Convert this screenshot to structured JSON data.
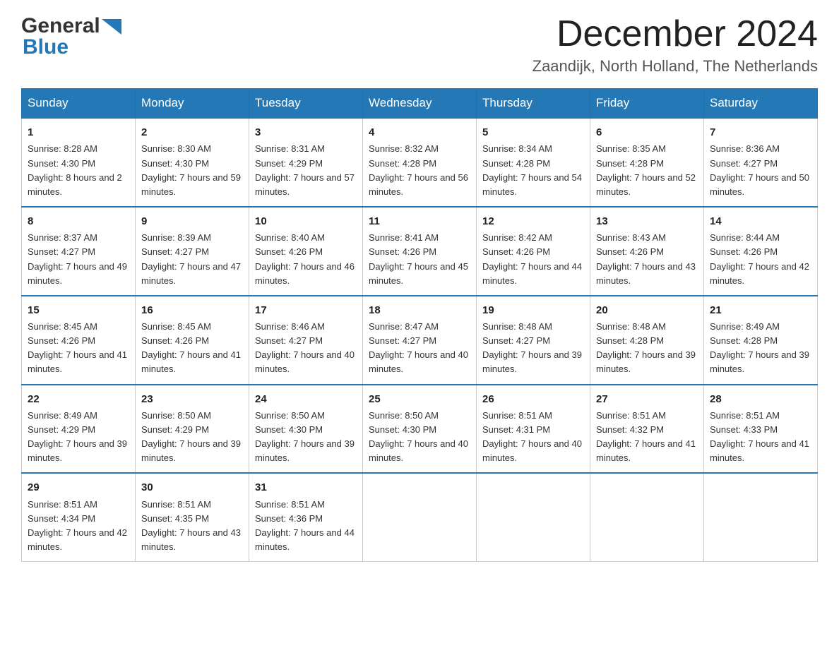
{
  "header": {
    "logo_general": "General",
    "logo_blue": "Blue",
    "month_title": "December 2024",
    "location": "Zaandijk, North Holland, The Netherlands"
  },
  "weekdays": [
    "Sunday",
    "Monday",
    "Tuesday",
    "Wednesday",
    "Thursday",
    "Friday",
    "Saturday"
  ],
  "weeks": [
    [
      {
        "day": "1",
        "sunrise": "8:28 AM",
        "sunset": "4:30 PM",
        "daylight": "8 hours and 2 minutes."
      },
      {
        "day": "2",
        "sunrise": "8:30 AM",
        "sunset": "4:30 PM",
        "daylight": "7 hours and 59 minutes."
      },
      {
        "day": "3",
        "sunrise": "8:31 AM",
        "sunset": "4:29 PM",
        "daylight": "7 hours and 57 minutes."
      },
      {
        "day": "4",
        "sunrise": "8:32 AM",
        "sunset": "4:28 PM",
        "daylight": "7 hours and 56 minutes."
      },
      {
        "day": "5",
        "sunrise": "8:34 AM",
        "sunset": "4:28 PM",
        "daylight": "7 hours and 54 minutes."
      },
      {
        "day": "6",
        "sunrise": "8:35 AM",
        "sunset": "4:28 PM",
        "daylight": "7 hours and 52 minutes."
      },
      {
        "day": "7",
        "sunrise": "8:36 AM",
        "sunset": "4:27 PM",
        "daylight": "7 hours and 50 minutes."
      }
    ],
    [
      {
        "day": "8",
        "sunrise": "8:37 AM",
        "sunset": "4:27 PM",
        "daylight": "7 hours and 49 minutes."
      },
      {
        "day": "9",
        "sunrise": "8:39 AM",
        "sunset": "4:27 PM",
        "daylight": "7 hours and 47 minutes."
      },
      {
        "day": "10",
        "sunrise": "8:40 AM",
        "sunset": "4:26 PM",
        "daylight": "7 hours and 46 minutes."
      },
      {
        "day": "11",
        "sunrise": "8:41 AM",
        "sunset": "4:26 PM",
        "daylight": "7 hours and 45 minutes."
      },
      {
        "day": "12",
        "sunrise": "8:42 AM",
        "sunset": "4:26 PM",
        "daylight": "7 hours and 44 minutes."
      },
      {
        "day": "13",
        "sunrise": "8:43 AM",
        "sunset": "4:26 PM",
        "daylight": "7 hours and 43 minutes."
      },
      {
        "day": "14",
        "sunrise": "8:44 AM",
        "sunset": "4:26 PM",
        "daylight": "7 hours and 42 minutes."
      }
    ],
    [
      {
        "day": "15",
        "sunrise": "8:45 AM",
        "sunset": "4:26 PM",
        "daylight": "7 hours and 41 minutes."
      },
      {
        "day": "16",
        "sunrise": "8:45 AM",
        "sunset": "4:26 PM",
        "daylight": "7 hours and 41 minutes."
      },
      {
        "day": "17",
        "sunrise": "8:46 AM",
        "sunset": "4:27 PM",
        "daylight": "7 hours and 40 minutes."
      },
      {
        "day": "18",
        "sunrise": "8:47 AM",
        "sunset": "4:27 PM",
        "daylight": "7 hours and 40 minutes."
      },
      {
        "day": "19",
        "sunrise": "8:48 AM",
        "sunset": "4:27 PM",
        "daylight": "7 hours and 39 minutes."
      },
      {
        "day": "20",
        "sunrise": "8:48 AM",
        "sunset": "4:28 PM",
        "daylight": "7 hours and 39 minutes."
      },
      {
        "day": "21",
        "sunrise": "8:49 AM",
        "sunset": "4:28 PM",
        "daylight": "7 hours and 39 minutes."
      }
    ],
    [
      {
        "day": "22",
        "sunrise": "8:49 AM",
        "sunset": "4:29 PM",
        "daylight": "7 hours and 39 minutes."
      },
      {
        "day": "23",
        "sunrise": "8:50 AM",
        "sunset": "4:29 PM",
        "daylight": "7 hours and 39 minutes."
      },
      {
        "day": "24",
        "sunrise": "8:50 AM",
        "sunset": "4:30 PM",
        "daylight": "7 hours and 39 minutes."
      },
      {
        "day": "25",
        "sunrise": "8:50 AM",
        "sunset": "4:30 PM",
        "daylight": "7 hours and 40 minutes."
      },
      {
        "day": "26",
        "sunrise": "8:51 AM",
        "sunset": "4:31 PM",
        "daylight": "7 hours and 40 minutes."
      },
      {
        "day": "27",
        "sunrise": "8:51 AM",
        "sunset": "4:32 PM",
        "daylight": "7 hours and 41 minutes."
      },
      {
        "day": "28",
        "sunrise": "8:51 AM",
        "sunset": "4:33 PM",
        "daylight": "7 hours and 41 minutes."
      }
    ],
    [
      {
        "day": "29",
        "sunrise": "8:51 AM",
        "sunset": "4:34 PM",
        "daylight": "7 hours and 42 minutes."
      },
      {
        "day": "30",
        "sunrise": "8:51 AM",
        "sunset": "4:35 PM",
        "daylight": "7 hours and 43 minutes."
      },
      {
        "day": "31",
        "sunrise": "8:51 AM",
        "sunset": "4:36 PM",
        "daylight": "7 hours and 44 minutes."
      },
      null,
      null,
      null,
      null
    ]
  ],
  "labels": {
    "sunrise": "Sunrise:",
    "sunset": "Sunset:",
    "daylight": "Daylight:"
  }
}
